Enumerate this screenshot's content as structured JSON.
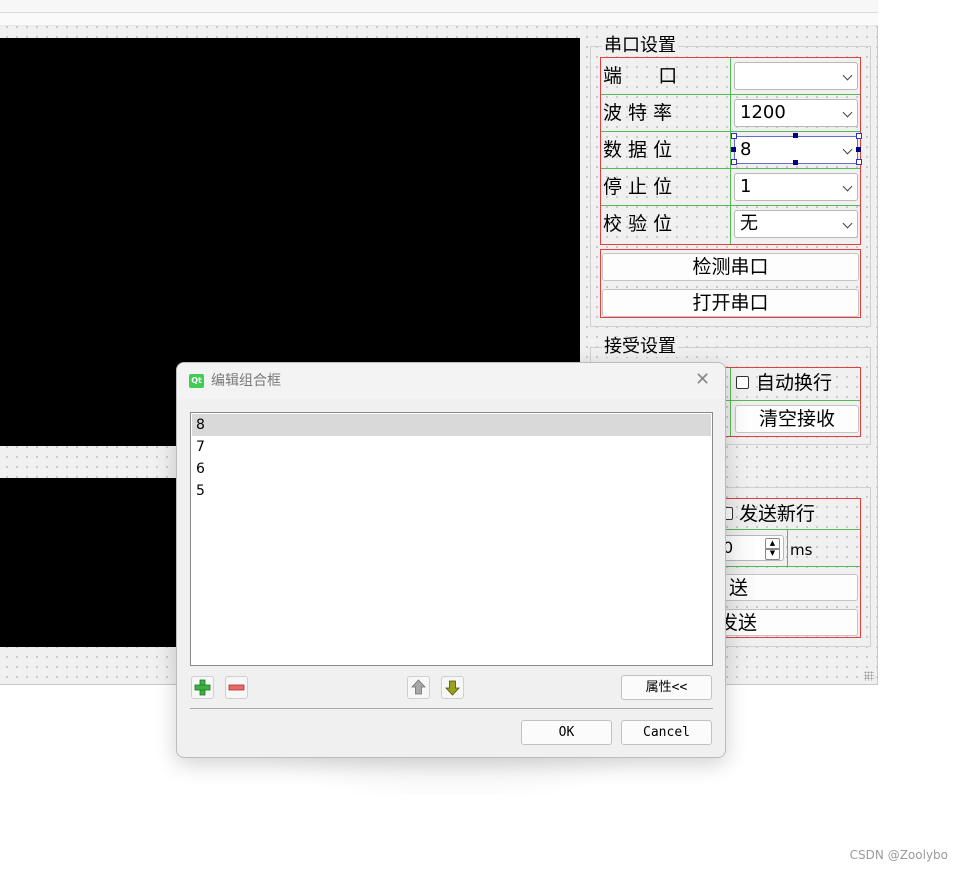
{
  "serial_settings": {
    "group_title": "串口设置",
    "rows": [
      {
        "label": "端      口",
        "value": ""
      },
      {
        "label": "波 特 率",
        "value": "1200"
      },
      {
        "label": "数 据 位",
        "value": "8"
      },
      {
        "label": "停 止 位",
        "value": "1"
      },
      {
        "label": "校 验 位",
        "value": "无"
      }
    ],
    "detect_button": "检测串口",
    "open_button": "打开串口"
  },
  "receive_settings": {
    "group_title": "接受设置",
    "auto_newline_label": "自动换行",
    "clear_button": "清空接收"
  },
  "send_settings": {
    "send_newline_label": "发送新行",
    "interval_value": "0",
    "interval_unit": "ms",
    "send_button_partial": "送",
    "timed_send_partial": "发送"
  },
  "dialog": {
    "title": "编辑组合框",
    "close_glyph": "✕",
    "items": [
      "8",
      "7",
      "6",
      "5"
    ],
    "selected_index": 0,
    "properties_button": "属性<<",
    "ok_button": "OK",
    "cancel_button": "Cancel"
  },
  "watermark": "CSDN @Zoolybo",
  "colors": {
    "layout_red": "#e04040",
    "layout_green": "#56b856",
    "qt_green": "#41cd52"
  }
}
